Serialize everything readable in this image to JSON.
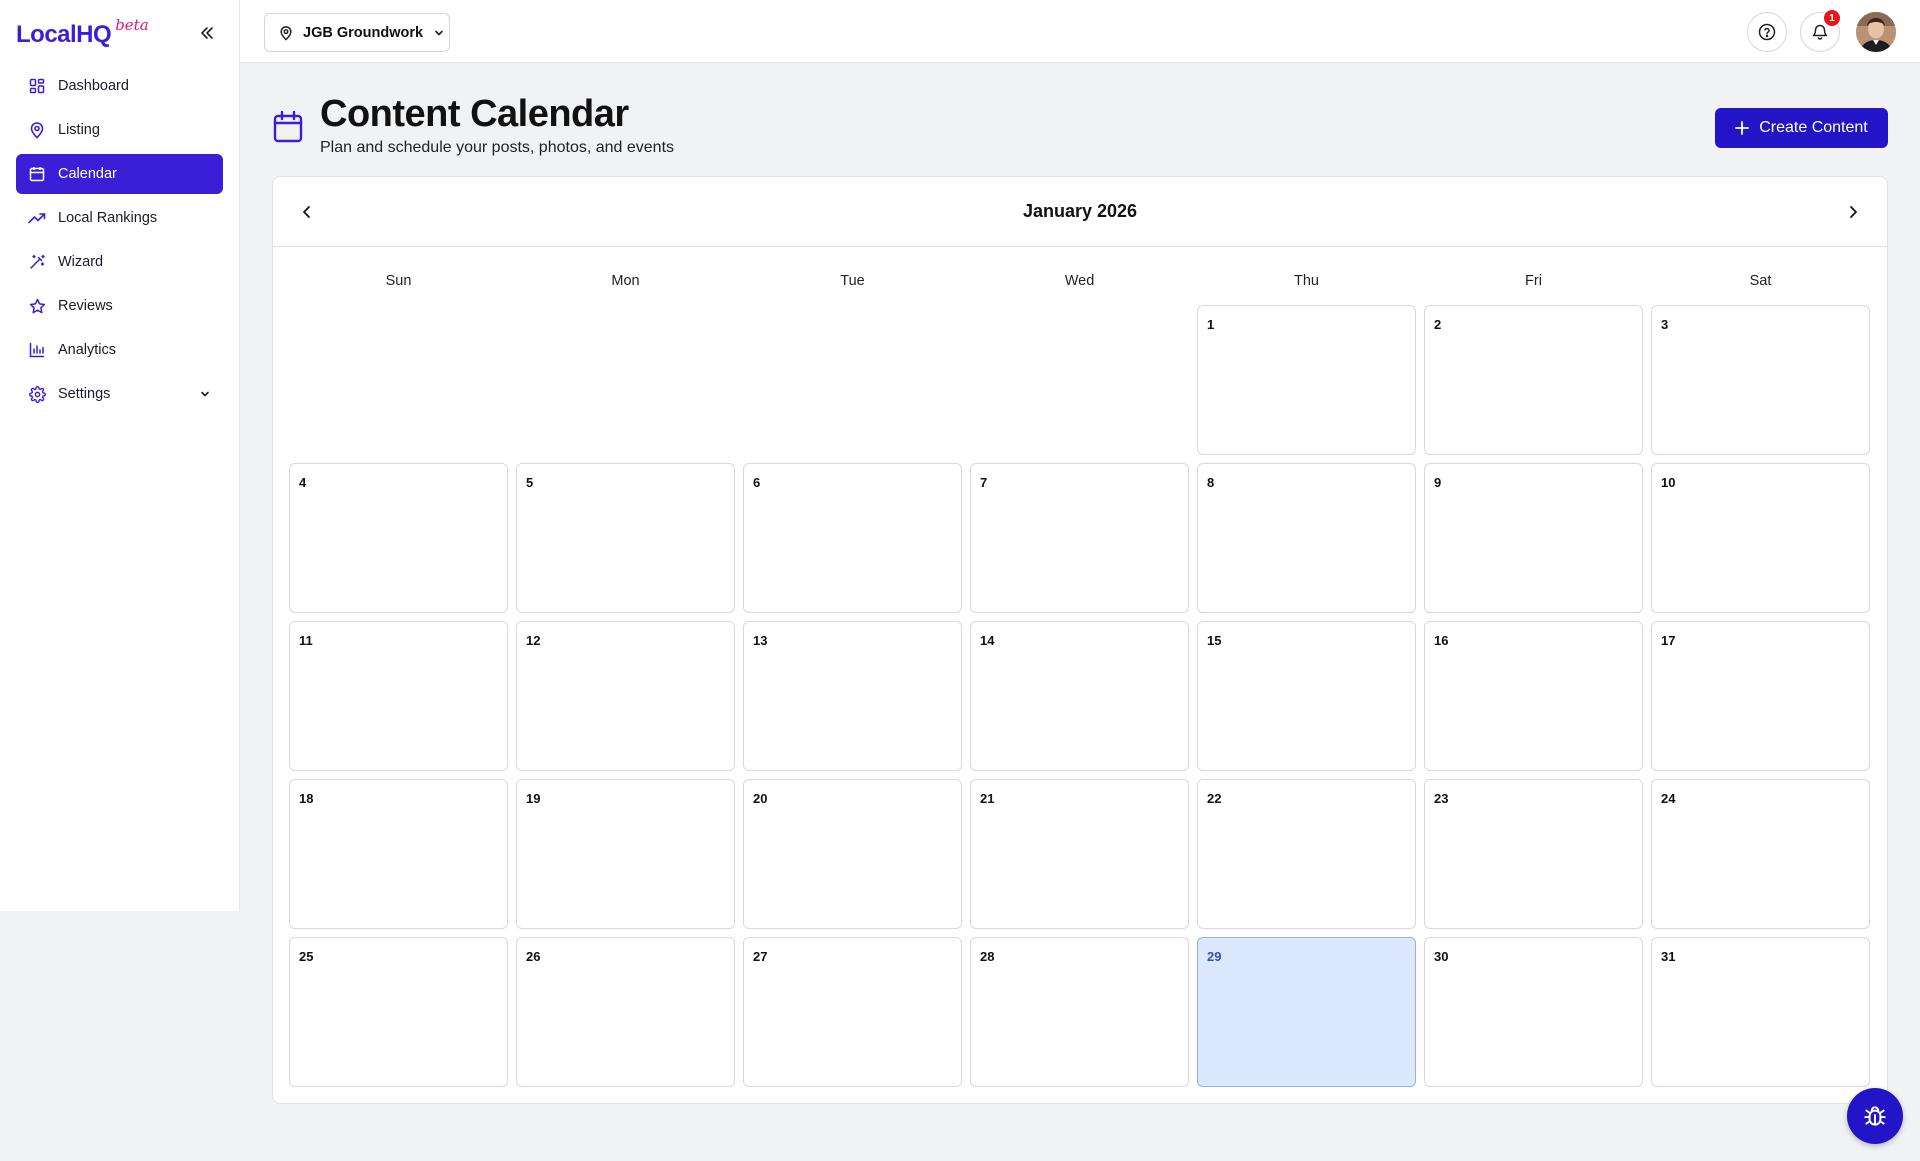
{
  "brand": {
    "name": "LocalHQ",
    "tag": "beta",
    "accent": "#3b1fd6",
    "tag_color": "#e0147a"
  },
  "sidebar": {
    "items": [
      {
        "label": "Dashboard",
        "icon": "dashboard-icon"
      },
      {
        "label": "Listing",
        "icon": "map-pin-icon"
      },
      {
        "label": "Calendar",
        "icon": "calendar-icon",
        "active": true
      },
      {
        "label": "Local Rankings",
        "icon": "trending-up-icon"
      },
      {
        "label": "Wizard",
        "icon": "magic-wand-icon"
      },
      {
        "label": "Reviews",
        "icon": "star-icon"
      },
      {
        "label": "Analytics",
        "icon": "bar-chart-icon"
      },
      {
        "label": "Settings",
        "icon": "gear-icon",
        "expandable": true
      }
    ]
  },
  "topbar": {
    "location": "JGB Groundwork",
    "notifications_count": "1"
  },
  "page": {
    "title": "Content Calendar",
    "subtitle": "Plan and schedule your posts, photos, and events",
    "create_label": "Create Content"
  },
  "calendar": {
    "month_label": "January 2026",
    "weekdays": [
      "Sun",
      "Mon",
      "Tue",
      "Wed",
      "Thu",
      "Fri",
      "Sat"
    ],
    "first_weekday_index": 4,
    "days_in_month": 31,
    "today": 29,
    "today_color": "#dbe8fd"
  }
}
